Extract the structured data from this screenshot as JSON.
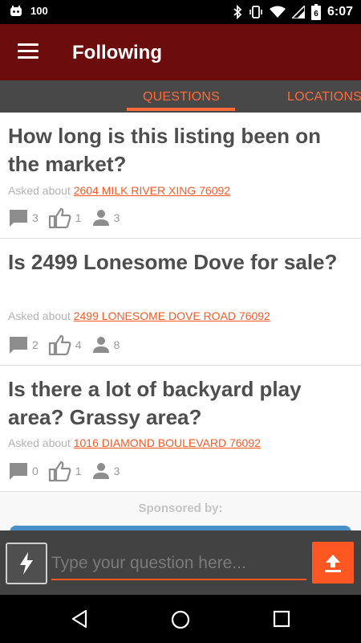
{
  "status_bar": {
    "notification_count": "100",
    "time": "6:07",
    "battery_level": "6"
  },
  "app_bar": {
    "title": "Following"
  },
  "tabs": [
    {
      "label": "QUESTIONS"
    },
    {
      "label": "LOCATIONS"
    }
  ],
  "cards": [
    {
      "question": "How long is this listing been on the market?",
      "asked_prefix": "Asked about",
      "location": "2604 MILK RIVER XING 76092",
      "comments": "3",
      "likes": "1",
      "followers": "3"
    },
    {
      "question": "Is 2499 Lonesome Dove for sale?",
      "asked_prefix": "Asked about",
      "location": "2499 LONESOME DOVE ROAD 76092",
      "comments": "2",
      "likes": "4",
      "followers": "8"
    },
    {
      "question": "Is there a lot of backyard play area? Grassy area?",
      "asked_prefix": "Asked about",
      "location": "1016 DIAMOND BOULEVARD 76092",
      "comments": "0",
      "likes": "1",
      "followers": "3"
    }
  ],
  "sponsored_label": "Sponsored by:",
  "composer": {
    "placeholder": "Type your question here..."
  },
  "colors": {
    "primary_dark": "#6d0c0c",
    "accent": "#ff5722",
    "tab_bar": "#484848"
  }
}
